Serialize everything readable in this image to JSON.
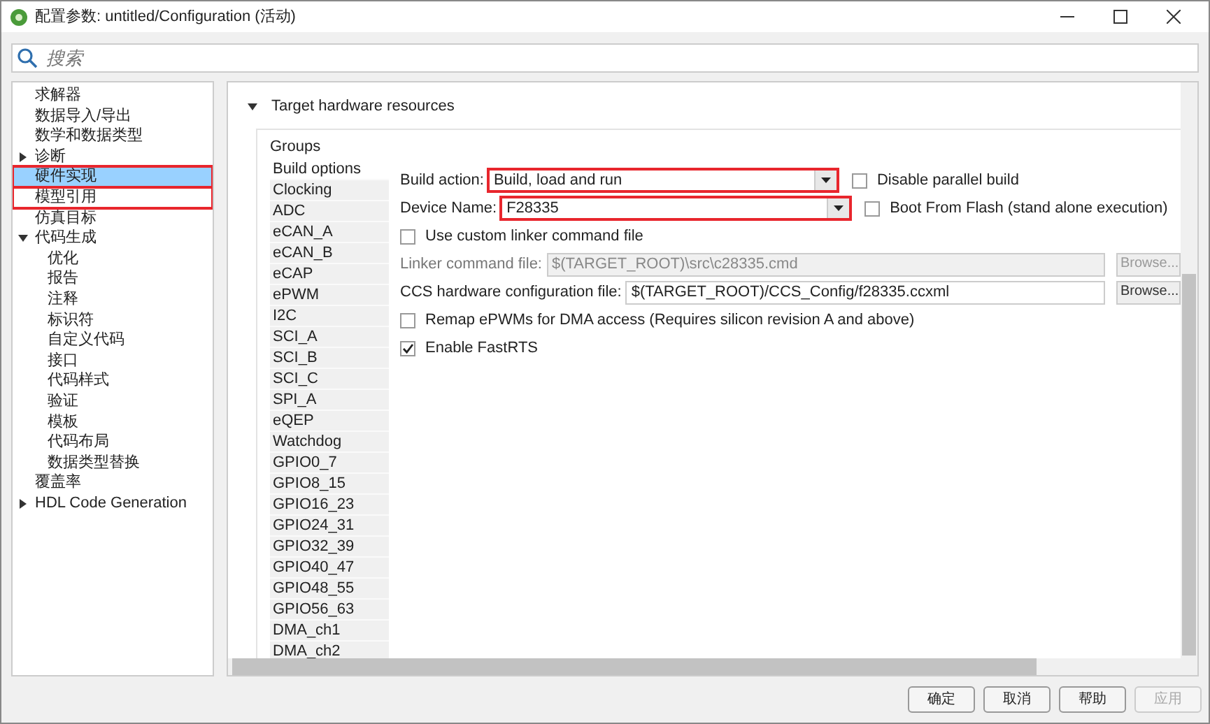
{
  "window": {
    "title": "配置参数: untitled/Configuration (活动)"
  },
  "search": {
    "placeholder": "搜索"
  },
  "tree": [
    {
      "label": "求解器"
    },
    {
      "label": "数据导入/导出"
    },
    {
      "label": "数学和数据类型"
    },
    {
      "label": "诊断",
      "expanded": false
    },
    {
      "label": "硬件实现",
      "selected": true,
      "highlighted": true
    },
    {
      "label": "模型引用",
      "selected": false,
      "highlighted": true
    },
    {
      "label": "仿真目标",
      "selected": false
    },
    {
      "label": "代码生成",
      "expanded": true,
      "children": [
        {
          "label": "优化"
        },
        {
          "label": "报告"
        },
        {
          "label": "注释"
        },
        {
          "label": "标识符"
        },
        {
          "label": "自定义代码"
        },
        {
          "label": "接口"
        },
        {
          "label": "代码样式"
        },
        {
          "label": "验证"
        },
        {
          "label": "模板"
        },
        {
          "label": "代码布局"
        },
        {
          "label": "数据类型替换"
        }
      ]
    },
    {
      "label": "覆盖率"
    },
    {
      "label": "HDL Code Generation",
      "expanded": false
    }
  ],
  "section": {
    "title": "Target hardware resources",
    "expanded": true
  },
  "groups": {
    "title": "Groups",
    "items": [
      {
        "label": "Build options",
        "selected": true
      },
      {
        "label": "Clocking",
        "selected": false
      },
      {
        "label": "ADC",
        "selected": false
      },
      {
        "label": "eCAN_A",
        "selected": false
      },
      {
        "label": "eCAN_B",
        "selected": false
      },
      {
        "label": "eCAP",
        "selected": false
      },
      {
        "label": "ePWM",
        "selected": false
      },
      {
        "label": "I2C",
        "selected": false
      },
      {
        "label": "SCI_A",
        "selected": false
      },
      {
        "label": "SCI_B",
        "selected": false
      },
      {
        "label": "SCI_C",
        "selected": false
      },
      {
        "label": "SPI_A",
        "selected": false
      },
      {
        "label": "eQEP",
        "selected": false
      },
      {
        "label": "Watchdog",
        "selected": false
      },
      {
        "label": "GPIO0_7",
        "selected": false
      },
      {
        "label": "GPIO8_15",
        "selected": false
      },
      {
        "label": "GPIO16_23",
        "selected": false
      },
      {
        "label": "GPIO24_31",
        "selected": false
      },
      {
        "label": "GPIO32_39",
        "selected": false
      },
      {
        "label": "GPIO40_47",
        "selected": false
      },
      {
        "label": "GPIO48_55",
        "selected": false
      },
      {
        "label": "GPIO56_63",
        "selected": false
      },
      {
        "label": "DMA_ch1",
        "selected": false
      },
      {
        "label": "DMA_ch2",
        "selected": false
      }
    ]
  },
  "form": [
    {
      "kind": "select",
      "label": "Build action:",
      "value": "Build, load and run",
      "highlighted": true,
      "side_checkbox": {
        "label": "Disable parallel build",
        "checked": false
      }
    },
    {
      "kind": "select",
      "label": "Device Name:",
      "value": "F28335",
      "highlighted": true,
      "side_checkbox": {
        "label": "Boot From Flash (stand alone execution)",
        "checked": false
      }
    },
    {
      "kind": "checkbox",
      "label": "Use custom linker command file",
      "checked": false
    },
    {
      "kind": "file",
      "label": "Linker command file:",
      "value": "$(TARGET_ROOT)\\src\\c28335.cmd",
      "button": "Browse...",
      "disabled": true
    },
    {
      "kind": "file",
      "label": "CCS hardware configuration file:",
      "value": "$(TARGET_ROOT)/CCS_Config/f28335.ccxml",
      "button": "Browse...",
      "disabled": false
    },
    {
      "kind": "checkbox",
      "label": "Remap ePWMs for DMA access (Requires silicon revision A and above)",
      "checked": false
    },
    {
      "kind": "checkbox",
      "label": "Enable FastRTS",
      "checked": true
    }
  ],
  "buttons": [
    {
      "label": "确定",
      "disabled": false
    },
    {
      "label": "取消",
      "disabled": false
    },
    {
      "label": "帮助",
      "disabled": false
    },
    {
      "label": "应用",
      "disabled": true
    }
  ]
}
